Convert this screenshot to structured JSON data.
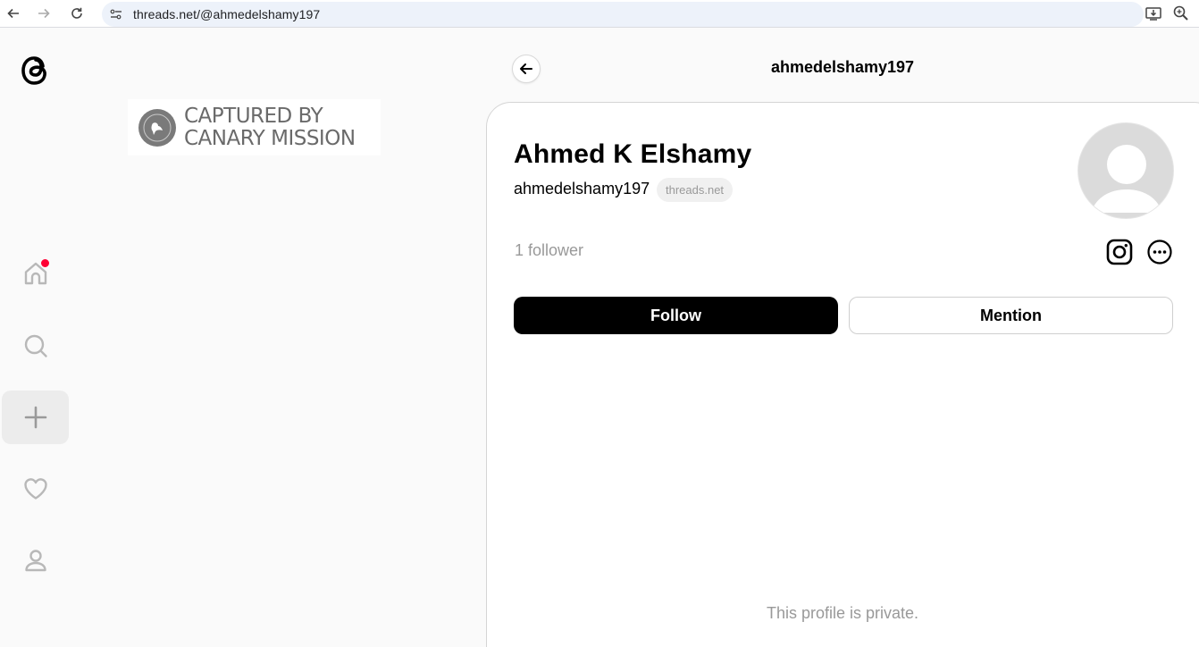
{
  "browser": {
    "url": "threads.net/@ahmedelshamy197"
  },
  "watermark": {
    "line1": "CAPTURED BY",
    "line2": "CANARY MISSION"
  },
  "rail": {
    "items": [
      {
        "icon": "home-icon",
        "notification": true
      },
      {
        "icon": "search-icon"
      },
      {
        "icon": "plus-icon",
        "active": true
      },
      {
        "icon": "heart-icon"
      },
      {
        "icon": "user-icon"
      }
    ]
  },
  "header": {
    "title": "ahmedelshamy197"
  },
  "profile": {
    "display_name": "Ahmed K Elshamy",
    "username": "ahmedelshamy197",
    "domain_badge": "threads.net",
    "followers": "1 follower",
    "follow_label": "Follow",
    "mention_label": "Mention",
    "private_message": "This profile is private."
  },
  "colors": {
    "notification_dot": "#ff0034",
    "primary_button": "#000000",
    "muted_text": "#999999"
  }
}
